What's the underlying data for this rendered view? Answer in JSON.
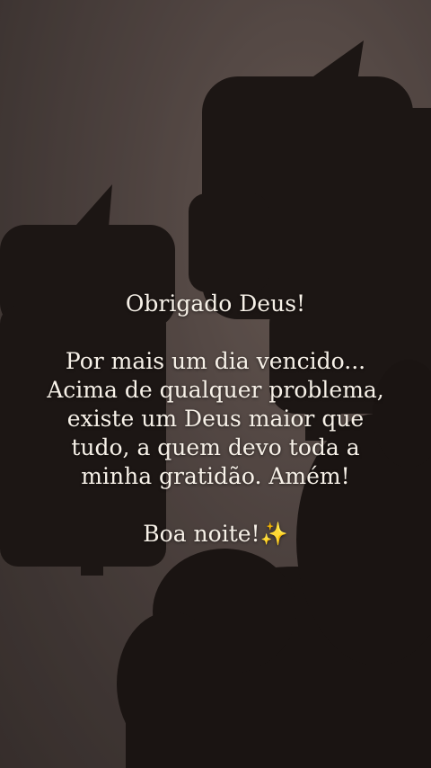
{
  "quote": {
    "title": "Obrigado Deus!",
    "body_lines": [
      "Por mais um dia vencido...",
      "Acima de qualquer problema,",
      "existe um Deus maior que",
      "tudo, a quem devo toda a",
      "minha gratidão. Amém!"
    ],
    "closing": "Boa noite!",
    "closing_emoji": "✨"
  },
  "colors": {
    "sky": "#5a4e4a",
    "silhouette": "#1c1614",
    "text": "#f7f1e8",
    "sparkle": "#ffd84a"
  }
}
